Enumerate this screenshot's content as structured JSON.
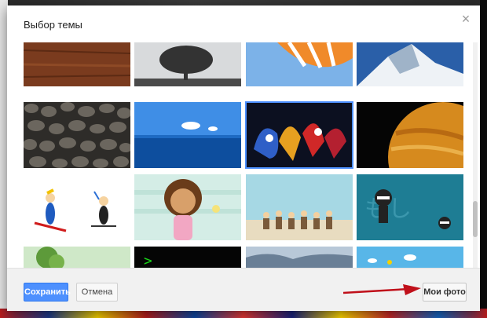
{
  "dialog": {
    "title": "Выбор темы",
    "close_glyph": "×",
    "close_icon": "close-icon"
  },
  "themes": [
    {
      "name": "wood",
      "selected": false
    },
    {
      "name": "tree",
      "selected": false
    },
    {
      "name": "umbrella",
      "selected": false
    },
    {
      "name": "mountain",
      "selected": false
    },
    {
      "name": "pebbles",
      "selected": false
    },
    {
      "name": "ocean",
      "selected": false
    },
    {
      "name": "graffiti",
      "selected": true
    },
    {
      "name": "planet",
      "selected": false
    },
    {
      "name": "skiers",
      "selected": false
    },
    {
      "name": "girl",
      "selected": false
    },
    {
      "name": "people-line",
      "selected": false
    },
    {
      "name": "ninja",
      "selected": false
    },
    {
      "name": "garden",
      "selected": false
    },
    {
      "name": "terminal",
      "selected": false
    },
    {
      "name": "hills",
      "selected": false
    },
    {
      "name": "sky-clouds",
      "selected": false
    }
  ],
  "terminal_prompt": ">",
  "ninja_text": "もし",
  "footer": {
    "save_label": "Сохранить",
    "cancel_label": "Отмена",
    "my_photos_label": "Мои фото"
  },
  "colors": {
    "accent": "#4d90fe",
    "arrow": "#c0101a"
  }
}
